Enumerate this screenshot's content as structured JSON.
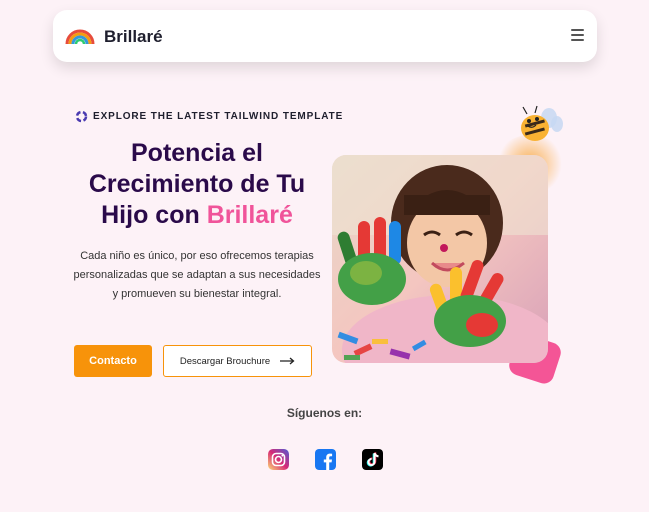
{
  "nav": {
    "brand": "Brillaré",
    "logo_icon": "rainbow-icon",
    "menu_icon": "hamburger-icon"
  },
  "hero": {
    "badge_icon": "spinner-icon",
    "badge": "EXPLORE THE LATEST TAILWIND TEMPLATE",
    "headline_part1": "Potencia el Crecimiento de Tu Hijo con",
    "headline_highlight": "Brillaré",
    "description": "Cada niño es único, por eso ofrecemos terapias personalizadas que se adaptan a sus necesidades y promueven su bienestar integral.",
    "primary_button": "Contacto",
    "secondary_button": "Descargar Brouchure",
    "secondary_button_icon": "arrow-right-icon",
    "image_icon": "child-painted-hands-photo",
    "decoration_icon": "bee-icon"
  },
  "social": {
    "title": "Síguenos en:",
    "items": [
      {
        "icon": "instagram-icon"
      },
      {
        "icon": "facebook-icon"
      },
      {
        "icon": "tiktok-icon"
      }
    ]
  },
  "colors": {
    "background": "#fdf2f7",
    "accent": "#f7930a",
    "highlight": "#f0549a",
    "heading": "#2a0a4a"
  }
}
